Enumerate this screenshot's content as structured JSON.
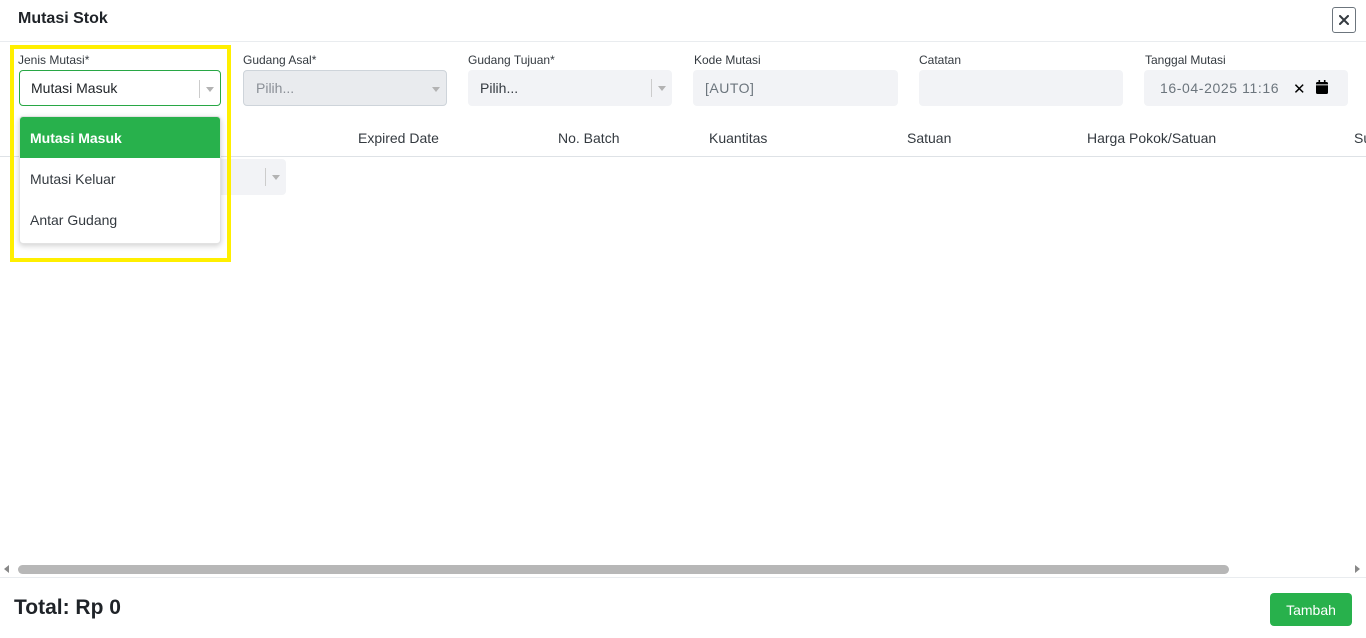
{
  "header": {
    "title": "Mutasi Stok",
    "close_label": "×"
  },
  "form": {
    "jenis_mutasi": {
      "label": "Jenis Mutasi*",
      "value": "Mutasi Masuk"
    },
    "gudang_asal": {
      "label": "Gudang Asal*",
      "value": "Pilih..."
    },
    "gudang_tujuan": {
      "label": "Gudang Tujuan*",
      "value": "Pilih..."
    },
    "kode_mutasi": {
      "label": "Kode Mutasi",
      "value": "[AUTO]"
    },
    "catatan": {
      "label": "Catatan",
      "value": ""
    },
    "tanggal_mutasi": {
      "label": "Tanggal Mutasi",
      "value": "16-04-2025 11:16",
      "clear_label": "✕"
    }
  },
  "dropdown": {
    "options": [
      "Mutasi Masuk",
      "Mutasi Keluar",
      "Antar Gudang"
    ],
    "selected": "Mutasi Masuk"
  },
  "table": {
    "headers": [
      "Expired Date",
      "No. Batch",
      "Kuantitas",
      "Satuan",
      "Harga Pokok/Satuan",
      "Su"
    ]
  },
  "footer": {
    "total": "Total: Rp 0",
    "add_label": "Tambah"
  },
  "colors": {
    "accent": "#28b14c",
    "highlight": "#ffef00"
  }
}
